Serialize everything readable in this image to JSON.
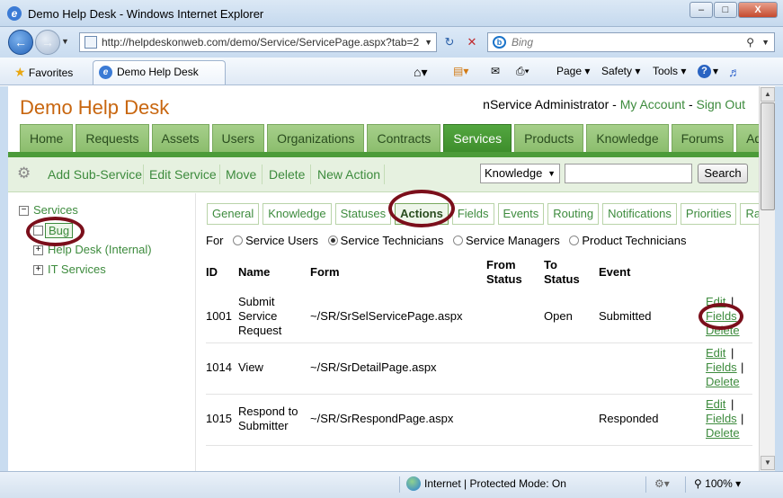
{
  "window": {
    "title": "Demo Help Desk - Windows Internet Explorer",
    "minimize": "–",
    "maximize": "□",
    "close": "X"
  },
  "address": {
    "url": "http://helpdeskonweb.com/demo/Service/ServicePage.aspx?tab=2",
    "search_placeholder": "Bing",
    "refresh_glyph": "↻",
    "stop_glyph": "✕"
  },
  "favorites": {
    "favorites_label": "Favorites",
    "tab_title": "Demo Help Desk",
    "commands": {
      "page": "Page",
      "safety": "Safety",
      "tools": "Tools",
      "help_glyph": "?"
    }
  },
  "site": {
    "brand": "Demo Help Desk",
    "user_name": "nService Administrator",
    "dash1": " - ",
    "my_account": "My Account",
    "dash2": " - ",
    "sign_out": "Sign Out"
  },
  "main_nav": {
    "items": [
      {
        "label": "Home"
      },
      {
        "label": "Requests"
      },
      {
        "label": "Assets"
      },
      {
        "label": "Users"
      },
      {
        "label": "Organizations"
      },
      {
        "label": "Contracts"
      },
      {
        "label": "Services"
      },
      {
        "label": "Products"
      },
      {
        "label": "Knowledge"
      },
      {
        "label": "Forums"
      },
      {
        "label": "Admin"
      }
    ],
    "active": "Services"
  },
  "sub_actions": {
    "add_sub_service": "Add Sub-Service",
    "edit_service": "Edit Service",
    "move": "Move",
    "delete": "Delete",
    "new_action": "New Action",
    "search_scope": "Knowledge",
    "search_button": "Search"
  },
  "tree": {
    "root": "Services",
    "items": [
      {
        "label": "Bug"
      },
      {
        "label": "Help Desk (Internal)"
      },
      {
        "label": "IT Services"
      }
    ],
    "selected": "Bug"
  },
  "sub_tabs": {
    "items": [
      {
        "label": "General"
      },
      {
        "label": "Knowledge"
      },
      {
        "label": "Statuses"
      },
      {
        "label": "Actions"
      },
      {
        "label": "Fields"
      },
      {
        "label": "Events"
      },
      {
        "label": "Routing"
      },
      {
        "label": "Notifications"
      },
      {
        "label": "Priorities"
      },
      {
        "label": "Ra"
      }
    ],
    "active": "Actions"
  },
  "for_filter": {
    "label": "For",
    "options": [
      {
        "label": "Service Users"
      },
      {
        "label": "Service Technicians"
      },
      {
        "label": "Service Managers"
      },
      {
        "label": "Product Technicians"
      }
    ],
    "selected": "Service Technicians"
  },
  "actions_table": {
    "headers": {
      "id": "ID",
      "name": "Name",
      "form": "Form",
      "from_status_1": "From",
      "from_status_2": "Status",
      "to_status_1": "To",
      "to_status_2": "Status",
      "event": "Event"
    },
    "rows": [
      {
        "id": "1001",
        "name_lines": [
          "Submit",
          "Service",
          "Request"
        ],
        "form": "~/SR/SrSelServicePage.aspx",
        "from_status": "",
        "to_status": "Open",
        "event": "Submitted"
      },
      {
        "id": "1014",
        "name_lines": [
          "View"
        ],
        "form": "~/SR/SrDetailPage.aspx",
        "from_status": "",
        "to_status": "",
        "event": ""
      },
      {
        "id": "1015",
        "name_lines": [
          "Respond to",
          "Submitter"
        ],
        "form": "~/SR/SrRespondPage.aspx",
        "from_status": "",
        "to_status": "",
        "event": "Responded"
      }
    ],
    "row_links": {
      "edit": "Edit",
      "fields": "Fields",
      "delete": "Delete",
      "sep": "|"
    }
  },
  "status_bar": {
    "zone": "Internet | Protected Mode: On",
    "zoom": "100%"
  },
  "colors": {
    "brand": "#c8660f",
    "link_green": "#3d8b3d",
    "nav_active": "#4c9b39",
    "annotation_ring": "#7b0f1b"
  }
}
